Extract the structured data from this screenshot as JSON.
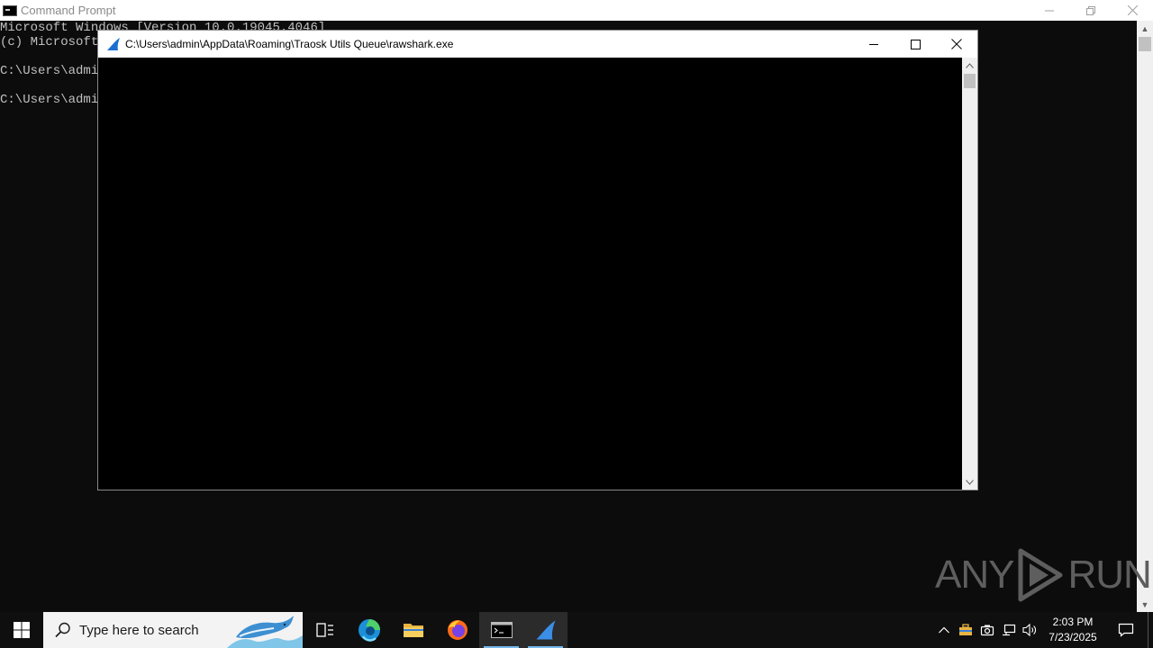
{
  "background_window": {
    "title": "Command Prompt",
    "lines": [
      "Microsoft Windows [Version 10.0.19045.4046]",
      "(c) Microsoft",
      "",
      "C:\\Users\\admir",
      "",
      "C:\\Users\\admir"
    ]
  },
  "foreground_window": {
    "title": "C:\\Users\\admin\\AppData\\Roaming\\Traosk Utils Queue\\rawshark.exe"
  },
  "watermark": {
    "left": "ANY",
    "right": "RUN"
  },
  "taskbar": {
    "search_placeholder": "Type here to search",
    "time": "2:03 PM",
    "date": "7/23/2025"
  },
  "colors": {
    "accent_underline": "#76b9ed",
    "taskbar_bg": "#0f0f0f",
    "console_bg": "#0c0c0c"
  }
}
